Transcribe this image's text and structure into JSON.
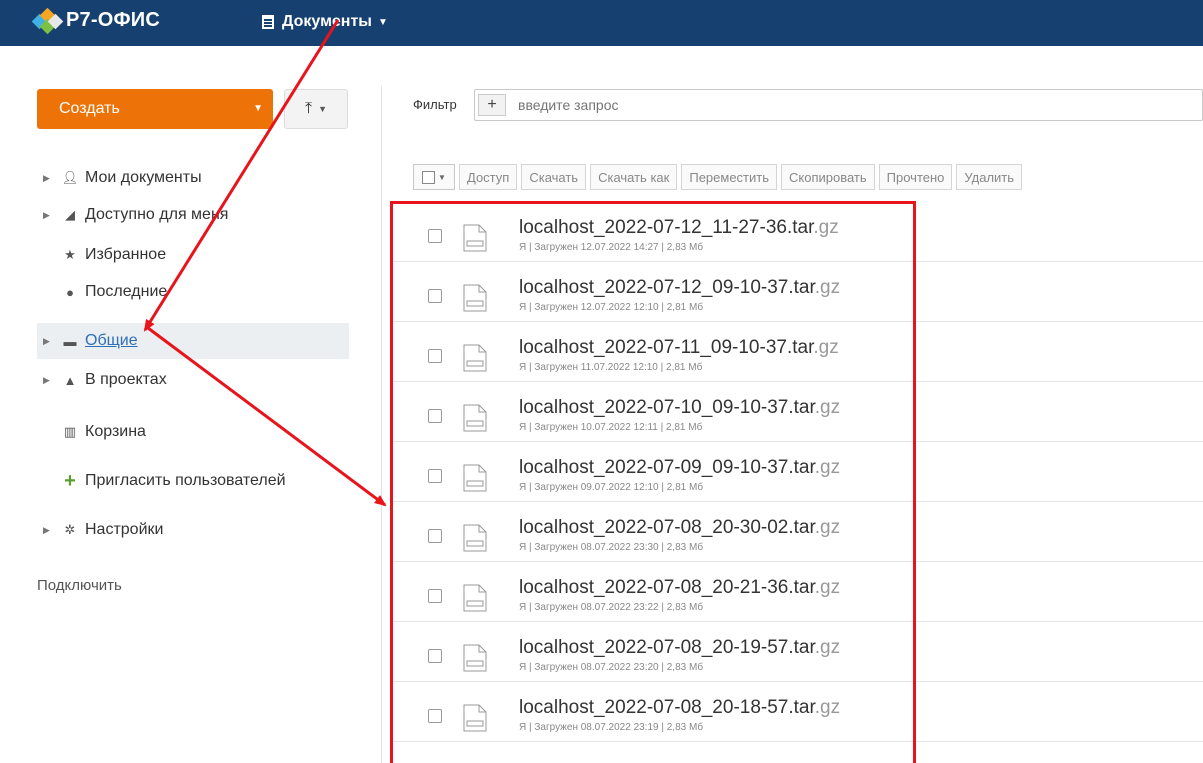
{
  "header": {
    "logo_text": "Р7-ОФИС",
    "module_label": "Документы",
    "bg_color": "#15406f"
  },
  "sidebar": {
    "create_label": "Создать",
    "create_color": "#ed7309",
    "upload_icon": "upload-icon",
    "items": [
      {
        "label": "Мои документы",
        "icon": "user-icon"
      },
      {
        "label": "Доступно для меня",
        "icon": "share-icon"
      },
      {
        "label": "Избранное",
        "icon": "star-icon"
      },
      {
        "label": "Последние",
        "icon": "clock-icon"
      },
      {
        "label": "Общие",
        "icon": "briefcase-icon",
        "active": true
      },
      {
        "label": "В проектах",
        "icon": "projects-icon"
      },
      {
        "label": "Корзина",
        "icon": "trash-icon"
      },
      {
        "label": "Пригласить пользователей",
        "icon": "plus-icon"
      },
      {
        "label": "Настройки",
        "icon": "gear-icon"
      }
    ],
    "connect_label": "Подключить"
  },
  "filter": {
    "label": "Фильтр",
    "placeholder": "введите запрос"
  },
  "toolbar": {
    "buttons": [
      "Доступ",
      "Скачать",
      "Скачать как",
      "Переместить",
      "Скопировать",
      "Прочтено",
      "Удалить"
    ]
  },
  "files": [
    {
      "name": "localhost_2022-07-12_11-27-36.tar",
      "ext": ".gz",
      "meta": "Я | Загружен 12.07.2022 14:27 | 2,83 Мб"
    },
    {
      "name": "localhost_2022-07-12_09-10-37.tar",
      "ext": ".gz",
      "meta": "Я | Загружен 12.07.2022 12:10 | 2,81 Мб"
    },
    {
      "name": "localhost_2022-07-11_09-10-37.tar",
      "ext": ".gz",
      "meta": "Я | Загружен 11.07.2022 12:10 | 2,81 Мб"
    },
    {
      "name": "localhost_2022-07-10_09-10-37.tar",
      "ext": ".gz",
      "meta": "Я | Загружен 10.07.2022 12:11 | 2,81 Мб"
    },
    {
      "name": "localhost_2022-07-09_09-10-37.tar",
      "ext": ".gz",
      "meta": "Я | Загружен 09.07.2022 12:10 | 2,81 Мб"
    },
    {
      "name": "localhost_2022-07-08_20-30-02.tar",
      "ext": ".gz",
      "meta": "Я | Загружен 08.07.2022 23:30 | 2,83 Мб"
    },
    {
      "name": "localhost_2022-07-08_20-21-36.tar",
      "ext": ".gz",
      "meta": "Я | Загружен 08.07.2022 23:22 | 2,83 Мб"
    },
    {
      "name": "localhost_2022-07-08_20-19-57.tar",
      "ext": ".gz",
      "meta": "Я | Загружен 08.07.2022 23:20 | 2,83 Мб"
    },
    {
      "name": "localhost_2022-07-08_20-18-57.tar",
      "ext": ".gz",
      "meta": "Я | Загружен 08.07.2022 23:19 | 2,83 Мб"
    }
  ],
  "annotation": {
    "color": "#e8141b"
  }
}
